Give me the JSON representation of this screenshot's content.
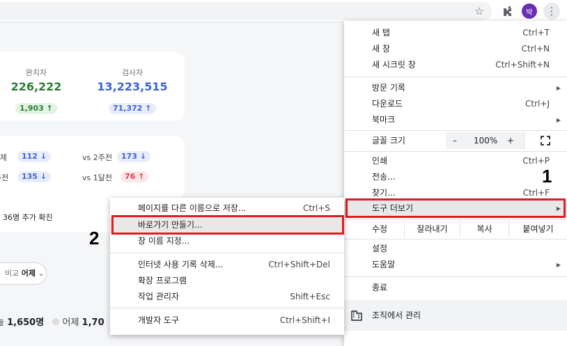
{
  "toolbar": {
    "avatar_text": "박",
    "icons": [
      "star-icon",
      "extensions-icon",
      "kebab-menu-icon"
    ]
  },
  "page": {
    "stats": [
      {
        "label": "완치자",
        "value": "226,222",
        "delta": "1,903",
        "direction": "up",
        "color": "#2e7d32"
      },
      {
        "label": "검사자",
        "value": "13,223,515",
        "delta": "71,372",
        "direction": "up",
        "color": "#3b63d6"
      }
    ],
    "compare_rows": [
      {
        "left_label": "제",
        "left_value": "112",
        "left_dir": "down",
        "right_label": "vs 2주전",
        "right_value": "173",
        "right_dir": "down"
      },
      {
        "left_label": "주전",
        "left_value": "135",
        "left_dir": "down",
        "right_label": "vs 1달전",
        "right_value": "76",
        "right_dir": "up"
      }
    ],
    "added_text": "36명 추가 확진",
    "dropdown": {
      "prefix": "비교",
      "value": "어제"
    },
    "bottom": {
      "prefix": "늘",
      "today_value": "1,650명",
      "yesterday_label": "어제",
      "yesterday_value": "1,70"
    }
  },
  "menu": {
    "new_tab": {
      "label": "새 탭",
      "shortcut": "Ctrl+T"
    },
    "new_window": {
      "label": "새 창",
      "shortcut": "Ctrl+N"
    },
    "incognito": {
      "label": "새 시크릿 창",
      "shortcut": "Ctrl+Shift+N"
    },
    "history": {
      "label": "방문 기록"
    },
    "downloads": {
      "label": "다운로드",
      "shortcut": "Ctrl+J"
    },
    "bookmarks": {
      "label": "북마크"
    },
    "zoom": {
      "label": "글꼴 크기",
      "minus": "–",
      "value": "100%",
      "plus": "+"
    },
    "print": {
      "label": "인쇄",
      "shortcut": "Ctrl+P"
    },
    "cast": {
      "label": "전송..."
    },
    "find": {
      "label": "찾기...",
      "shortcut": "Ctrl+F"
    },
    "more_tools": {
      "label": "도구 더보기"
    },
    "edit": {
      "label": "수정",
      "cut": "잘라내기",
      "copy": "복사",
      "paste": "붙여넣기"
    },
    "settings": {
      "label": "설정"
    },
    "help": {
      "label": "도움말"
    },
    "exit": {
      "label": "종료"
    },
    "managed": {
      "label": "조직에서 관리"
    }
  },
  "submenu": {
    "save_page": {
      "label": "페이지를 다른 이름으로 저장...",
      "shortcut": "Ctrl+S"
    },
    "create_shortcut": {
      "label": "바로가기 만들기..."
    },
    "name_window": {
      "label": "창 이름 지정..."
    },
    "clear_data": {
      "label": "인터넷 사용 기록 삭제...",
      "shortcut": "Ctrl+Shift+Del"
    },
    "extensions": {
      "label": "확장 프로그램"
    },
    "task_manager": {
      "label": "작업 관리자",
      "shortcut": "Shift+Esc"
    },
    "dev_tools": {
      "label": "개발자 도구",
      "shortcut": "Ctrl+Shift+I"
    }
  },
  "annotations": {
    "step1": "1",
    "step2": "2"
  },
  "colors": {
    "highlight": "#e31b23",
    "green": "#2e7d32",
    "blue": "#3b63d6",
    "red": "#e53950"
  }
}
